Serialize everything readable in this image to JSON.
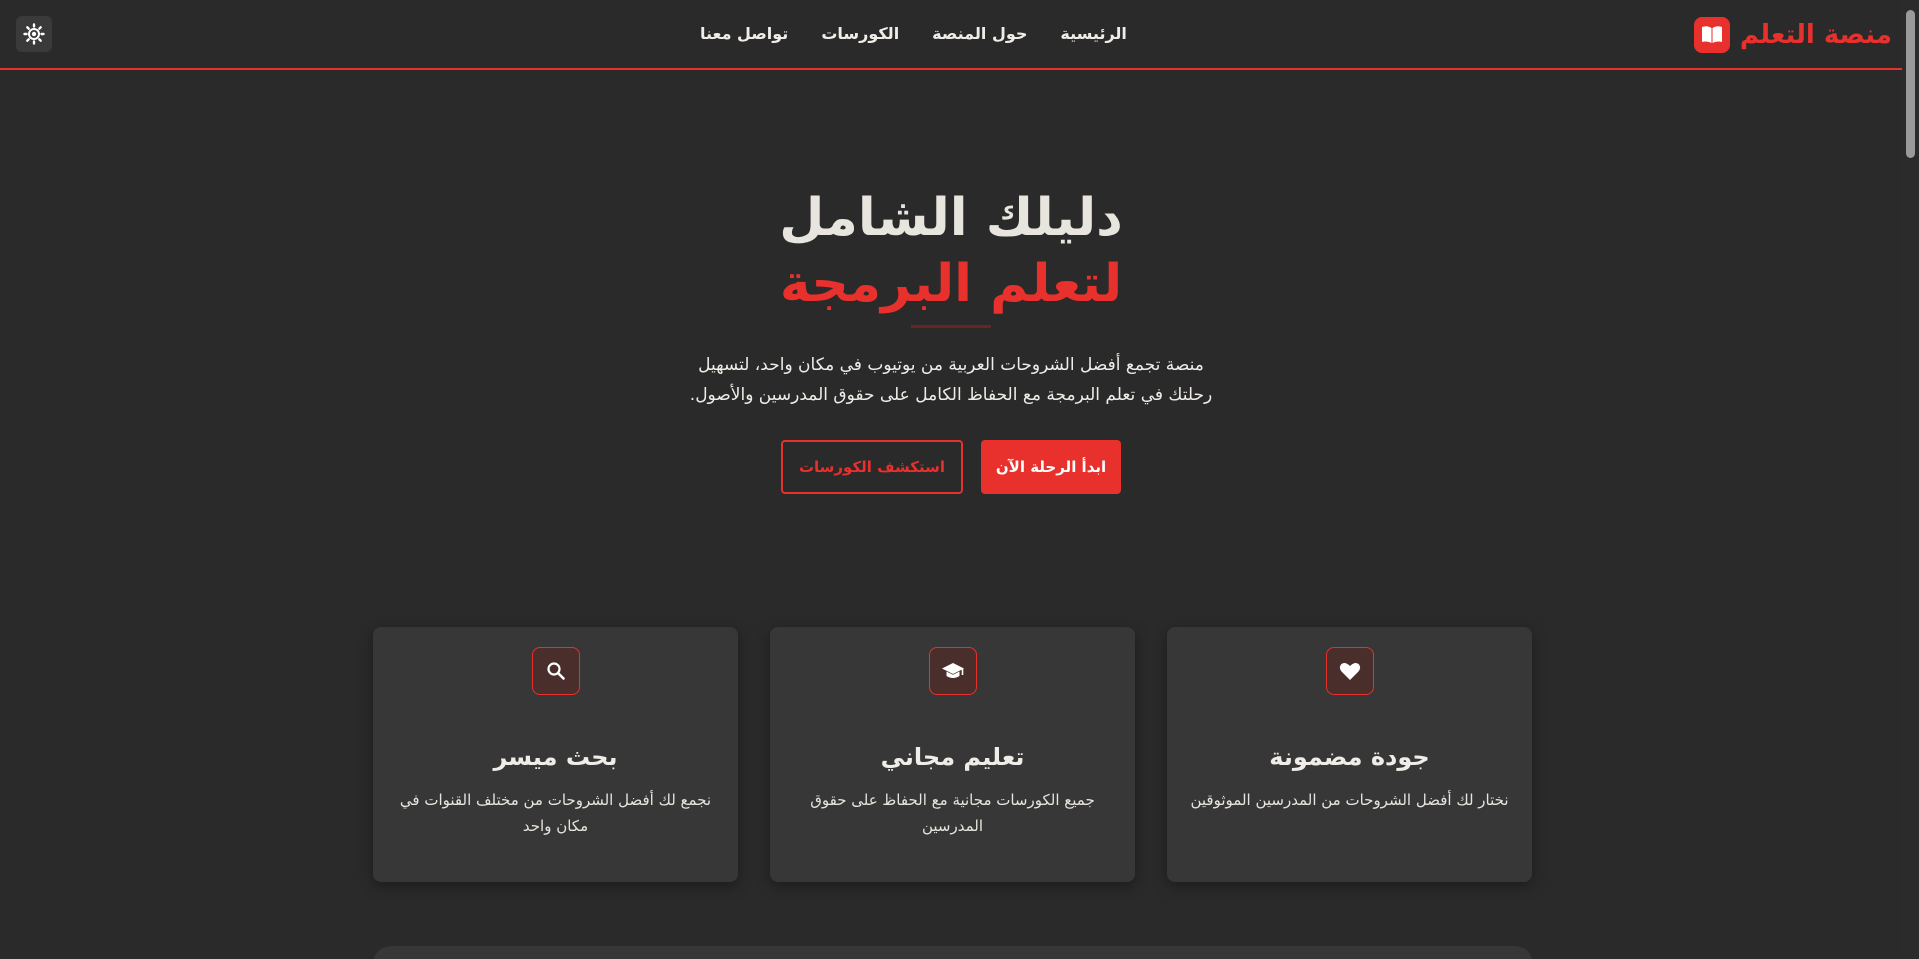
{
  "header": {
    "brand_name": "منصة التعلم",
    "nav": [
      "الرئيسية",
      "حول المنصة",
      "الكورسات",
      "تواصل معنا"
    ]
  },
  "hero": {
    "title_line1": "دليلك الشامل",
    "title_line2": "لتعلم البرمجة",
    "description_line1": "منصة تجمع أفضل الشروحات العربية من يوتيوب في مكان واحد، لتسهيل",
    "description_line2": "رحلتك في تعلم البرمجة مع الحفاظ الكامل على حقوق المدرسين والأصول.",
    "primary_button": "ابدأ الرحلة الآن",
    "secondary_button": "استكشف الكورسات"
  },
  "features": [
    {
      "icon": "search-icon",
      "title": "بحث ميسر",
      "description": "نجمع لك أفضل الشروحات من مختلف القنوات في مكان واحد"
    },
    {
      "icon": "graduation-cap-icon",
      "title": "تعليم مجاني",
      "description": "جميع الكورسات مجانية مع الحفاظ على حقوق المدرسين"
    },
    {
      "icon": "heart-icon",
      "title": "جودة مضمونة",
      "description": "نختار لك أفضل الشروحات من المدرسين الموثوقين"
    }
  ],
  "colors": {
    "accent": "#e8302c",
    "background": "#2a2a2a",
    "card": "#373737"
  }
}
